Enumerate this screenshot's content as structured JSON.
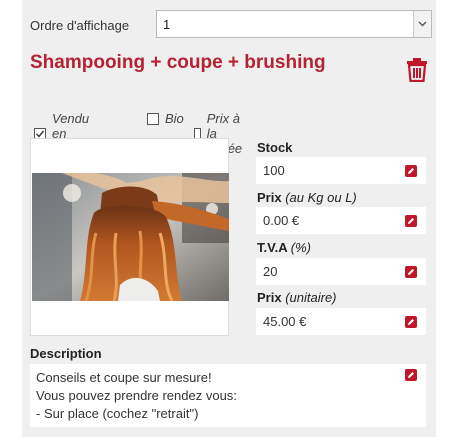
{
  "order": {
    "label": "Ordre d'affichage",
    "value": "1"
  },
  "product": {
    "title": "Shampooing + coupe + brushing"
  },
  "options": [
    {
      "label": "Vendu en ligne",
      "checked": true
    },
    {
      "label": "Bio",
      "checked": false
    },
    {
      "label": "Prix à la pesée",
      "checked": false
    }
  ],
  "photo": {
    "subject": "hairdresser-brushing-long-auburn-hair"
  },
  "fields": {
    "stock": {
      "label": "Stock",
      "value": "100"
    },
    "price_kg": {
      "label": "Prix",
      "hint": "(au Kg ou L)",
      "value": "0.00 €"
    },
    "tva": {
      "label": "T.V.A",
      "hint": "(%)",
      "value": "20"
    },
    "price_unit": {
      "label": "Prix",
      "hint": "(unitaire)",
      "value": "45.00 €"
    }
  },
  "description": {
    "label": "Description",
    "lines": [
      "Conseils et coupe sur mesure!",
      "Vous pouvez prendre rendez vous:",
      "- Sur place (cochez \"retrait\")"
    ]
  },
  "colors": {
    "accent": "#b52232",
    "panel": "#efefef"
  }
}
